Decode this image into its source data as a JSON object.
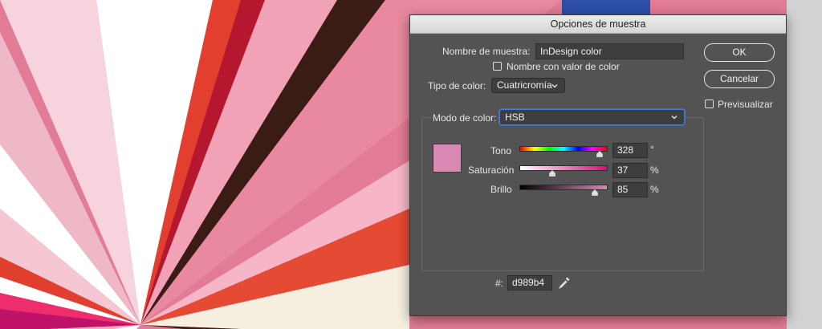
{
  "dialog": {
    "title": "Opciones de muestra",
    "swatch_name_label": "Nombre de muestra:",
    "swatch_name_value": "InDesign color",
    "name_with_value_label": "Nombre con valor de color",
    "color_type_label": "Tipo de color:",
    "color_type_value": "Cuatricromía",
    "color_mode_label": "Modo de color:",
    "color_mode_value": "HSB",
    "ok_label": "OK",
    "cancel_label": "Cancelar",
    "preview_label": "Previsualizar",
    "hue_label": "Tono",
    "hue_value": "328",
    "hue_unit": "°",
    "hue_level": 328,
    "hue_max": 360,
    "sat_label": "Saturación",
    "sat_value": "37",
    "sat_unit": "%",
    "sat_level": 37,
    "bri_label": "Brillo",
    "bri_value": "85",
    "bri_unit": "%",
    "bri_level": 85,
    "hex_label": "#:",
    "hex_value": "d989b4",
    "swatch_color": "#d989b4",
    "eyedropper_icon": "eyedropper-icon"
  }
}
